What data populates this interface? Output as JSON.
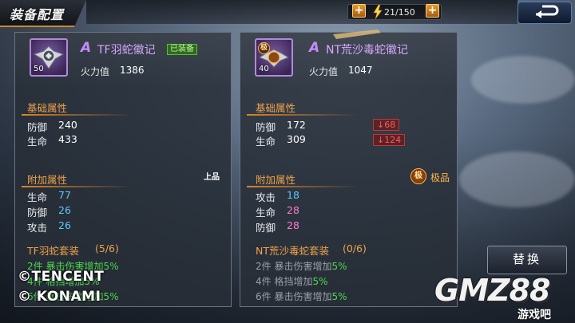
{
  "header": {
    "title": "装备配置",
    "stamina_counter": "21/150",
    "add_label": "+",
    "back_icon": "back-arrow-icon"
  },
  "left_item": {
    "level": "50",
    "grade": "A",
    "name": "TF羽蛇徽记",
    "status_tag": "已装备",
    "power_label": "火力值",
    "power_value": "1386",
    "base_title": "基础属性",
    "base_stats": [
      {
        "label": "防御",
        "value": "240"
      },
      {
        "label": "生命",
        "value": "433"
      }
    ],
    "extra_title": "附加属性",
    "extra_quality": "上品",
    "extra_stats": [
      {
        "label": "生命",
        "value": "77"
      },
      {
        "label": "防御",
        "value": "26"
      },
      {
        "label": "攻击",
        "value": "26"
      }
    ],
    "set_title": "TF羽蛇套装",
    "set_count": "(5/6)",
    "set_bonuses": [
      {
        "text": "2件 暴击伤害增加",
        "pct": "5%"
      },
      {
        "text": "4件 格挡增加",
        "pct": "5%"
      },
      {
        "text": "6件 暴击伤害增加",
        "pct": "5%"
      }
    ]
  },
  "right_item": {
    "level": "40",
    "grade": "A",
    "name": "NT荒沙毒蛇徽记",
    "power_label": "火力值",
    "power_value": "1047",
    "base_title": "基础属性",
    "base_stats": [
      {
        "label": "防御",
        "value": "172",
        "diff": "68"
      },
      {
        "label": "生命",
        "value": "309",
        "diff": "124"
      }
    ],
    "extra_title": "附加属性",
    "extra_quality_icon": "极",
    "extra_quality": "极品",
    "extra_stats": [
      {
        "label": "攻击",
        "value": "18"
      },
      {
        "label": "生命",
        "value": "28"
      },
      {
        "label": "防御",
        "value": "28"
      }
    ],
    "set_title": "NT荒沙毒蛇套装",
    "set_count": "(0/6)",
    "set_bonuses": [
      {
        "text": "2件 暴击伤害增加",
        "pct": "5%"
      },
      {
        "text": "4件 格挡增加",
        "pct": "5%"
      },
      {
        "text": "6件 暴击伤害增加",
        "pct": "5%"
      }
    ]
  },
  "actions": {
    "replace_label": "替换"
  },
  "watermark": {
    "copyright_1": "©TENCENT",
    "copyright_2": "© KONAMI",
    "logo_text": "GMZ88",
    "logo_sub": "游戏吧"
  },
  "colors": {
    "accent_orange": "#f0a24a",
    "grade_purple": "#c48cff",
    "set_active_green": "#4cd74c",
    "stat_blue": "#5cc8ff",
    "stat_pink": "#ff7ad0",
    "decrease_red": "#ff5a5a"
  }
}
